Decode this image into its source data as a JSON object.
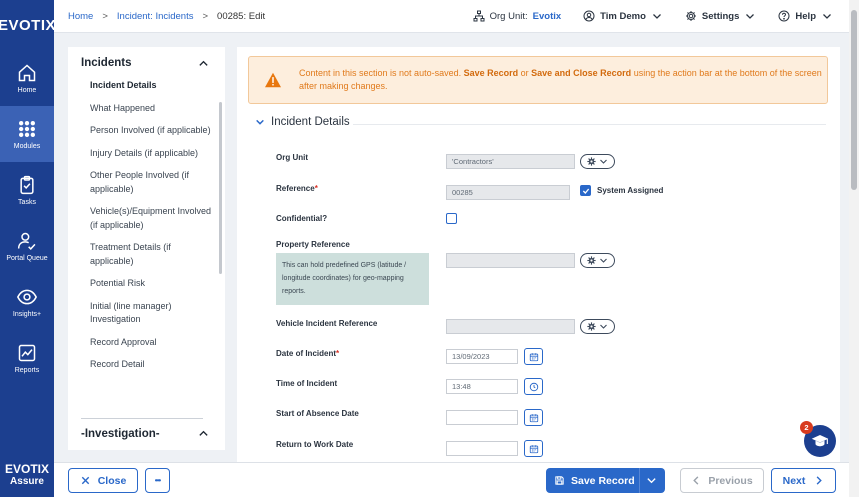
{
  "app": {
    "logo_text": "EVOTIX",
    "bottom_logo_line1": "EVOTIX",
    "bottom_logo_line2": "Assure"
  },
  "nav": {
    "items": [
      {
        "label": "Home",
        "icon": "home-icon"
      },
      {
        "label": "Modules",
        "icon": "grid-icon",
        "active": true
      },
      {
        "label": "Tasks",
        "icon": "clipboard-check-icon"
      },
      {
        "label": "Portal Queue",
        "icon": "person-check-icon"
      },
      {
        "label": "Insights+",
        "icon": "eye-icon"
      },
      {
        "label": "Reports",
        "icon": "chart-icon"
      }
    ]
  },
  "breadcrumb": {
    "home": "Home",
    "module": "Incident: Incidents",
    "current": "00285: Edit"
  },
  "topbar": {
    "org_label": "Org Unit:",
    "org_value": "Evotix",
    "user": "Tim Demo",
    "settings": "Settings",
    "help": "Help"
  },
  "sidemenu": {
    "title": "Incidents",
    "items": [
      {
        "label": "Incident Details",
        "active": true
      },
      {
        "label": "What Happened"
      },
      {
        "label": "Person Involved (if applicable)"
      },
      {
        "label": "Injury Details (if applicable)"
      },
      {
        "label": "Other People Involved (if applicable)"
      },
      {
        "label": "Vehicle(s)/Equipment Involved (if applicable)"
      },
      {
        "label": "Treatment Details (if applicable)"
      },
      {
        "label": "Potential Risk"
      },
      {
        "label": "Initial (line manager) Investigation"
      },
      {
        "label": "Record Approval"
      },
      {
        "label": "Record Detail"
      }
    ],
    "second_title": "-Investigation-"
  },
  "alert": {
    "text_before": "Content in this section is not auto-saved. ",
    "bold1": "Save Record",
    "text_mid": " or ",
    "bold2": "Save and Close Record",
    "text_after": " using the action bar at the bottom of the screen after making changes."
  },
  "section": {
    "title": "Incident Details"
  },
  "form": {
    "org_unit": {
      "label": "Org Unit",
      "value": "'Contractors'"
    },
    "reference": {
      "label": "Reference",
      "required": "*",
      "value": "00285",
      "system_assigned_label": "System Assigned",
      "system_assigned": true
    },
    "confidential": {
      "label": "Confidential?",
      "checked": false
    },
    "property_reference": {
      "label": "Property Reference",
      "hint": "This can hold predefined GPS (latitude / longitude coordinates) for geo-mapping reports.",
      "value": ""
    },
    "vehicle_incident_reference": {
      "label": "Vehicle Incident Reference",
      "value": ""
    },
    "date_of_incident": {
      "label": "Date of Incident",
      "required": "*",
      "value": "13/09/2023"
    },
    "time_of_incident": {
      "label": "Time of Incident",
      "value": "13:48"
    },
    "start_of_absence_date": {
      "label": "Start of Absence Date",
      "value": ""
    },
    "return_to_work_date": {
      "label": "Return to Work Date",
      "value": ""
    }
  },
  "actions": {
    "close": "Close",
    "more": "•••",
    "save": "Save Record",
    "previous": "Previous",
    "next": "Next"
  },
  "notifications": {
    "count": "2"
  },
  "colors": {
    "nav_bg": "#1c3f8f",
    "accent": "#2a68c9",
    "alert_bg": "#fdeedd",
    "alert_text": "#e07a1c"
  }
}
